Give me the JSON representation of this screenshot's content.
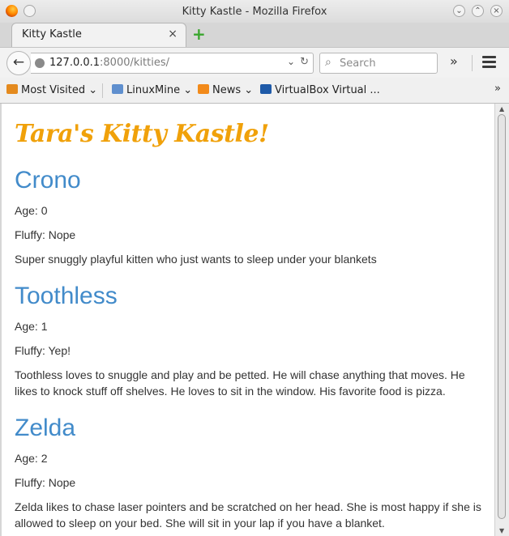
{
  "window": {
    "title": "Kitty Kastle - Mozilla Firefox"
  },
  "tab": {
    "label": "Kitty Kastle",
    "close": "×",
    "new_tab": "+"
  },
  "nav": {
    "url_host": "127.0.0.1",
    "url_path": ":8000/kitties/",
    "search_placeholder": "Search",
    "overflow": "»"
  },
  "bookmarks": {
    "items": [
      {
        "label": "Most Visited",
        "icon": "most-visited-icon"
      },
      {
        "label": "LinuxMine",
        "icon": "folder-icon"
      },
      {
        "label": "News",
        "icon": "rss-icon"
      },
      {
        "label": "VirtualBox Virtual ...",
        "icon": "virtualbox-icon"
      }
    ],
    "more": "»"
  },
  "page": {
    "title": "Tara's Kitty Kastle!",
    "kitties": [
      {
        "name": "Crono",
        "age": "Age: 0",
        "fluffy": "Fluffy: Nope",
        "description": "Super snuggly playful kitten who just wants to sleep under your blankets"
      },
      {
        "name": "Toothless",
        "age": "Age: 1",
        "fluffy": "Fluffy: Yep!",
        "description": "Toothless loves to snuggle and play and be petted. He will chase anything that moves. He likes to knock stuff off shelves. He loves to sit in the window. His favorite food is pizza."
      },
      {
        "name": "Zelda",
        "age": "Age: 2",
        "fluffy": "Fluffy: Nope",
        "description": "Zelda likes to chase laser pointers and be scratched on her head. She is most happy if she is allowed to sleep on your bed. She will sit in your lap if you have a blanket."
      }
    ]
  },
  "colors": {
    "title": "#f0a10a",
    "heading": "#428bca",
    "text": "#333333"
  }
}
